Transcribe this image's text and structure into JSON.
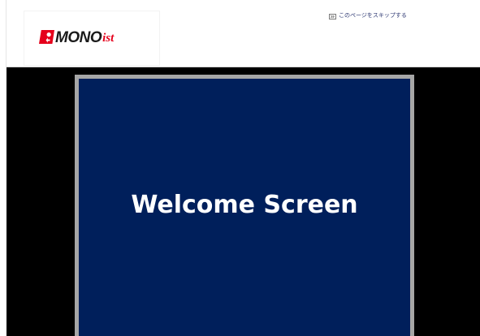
{
  "header": {
    "logo": {
      "wordmark": "MONO",
      "suffix": "ist",
      "mark_icon": "mono-ist-logo-mark-icon",
      "brand_red": "#e5001b",
      "brand_dark": "#1a1a1a"
    },
    "skip_link": {
      "icon": "skip-page-icon",
      "label": "このページをスキップする",
      "color": "#2f3a73"
    }
  },
  "welcome": {
    "title": "Welcome Screen",
    "panel_color": "#001f5b",
    "frame_color": "#a6a6a6",
    "background_color": "#000000"
  }
}
